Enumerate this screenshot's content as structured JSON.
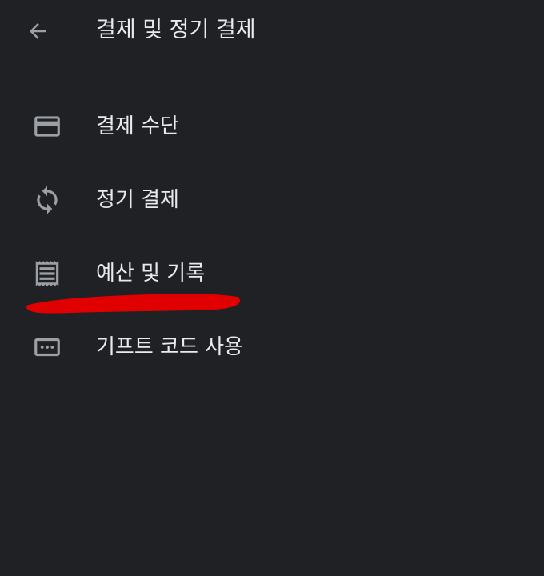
{
  "header": {
    "back_icon": "arrow-back-icon",
    "title": "결제 및 정기 결제"
  },
  "menu": {
    "items": [
      {
        "label": "결제 수단",
        "icon": "credit-card-icon"
      },
      {
        "label": "정기 결제",
        "icon": "sync-icon"
      },
      {
        "label": "예산 및 기록",
        "icon": "receipt-icon"
      },
      {
        "label": "기프트 코드 사용",
        "icon": "redeem-code-icon"
      }
    ]
  },
  "colors": {
    "background": "#202124",
    "text": "#e8eaed",
    "icon": "#9aa0a6",
    "annotation_stroke": "#e00000"
  }
}
